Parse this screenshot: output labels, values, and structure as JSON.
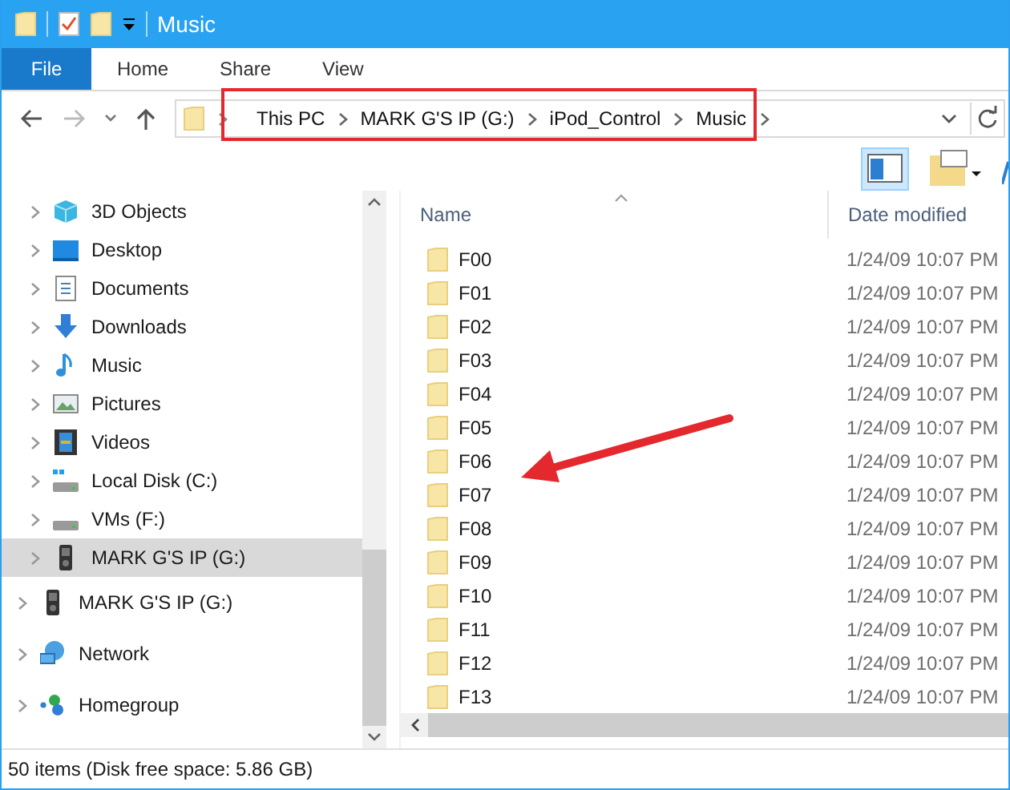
{
  "window": {
    "title": "Music"
  },
  "ribbon_tabs": [
    {
      "label": "File",
      "kind": "file"
    },
    {
      "label": "Home",
      "kind": "tab"
    },
    {
      "label": "Share",
      "kind": "tab"
    },
    {
      "label": "View",
      "kind": "tab"
    }
  ],
  "address": {
    "segments": [
      "This PC",
      "MARK G'S IP (G:)",
      "iPod_Control",
      "Music"
    ]
  },
  "sidebar": {
    "groups": [
      {
        "items": [
          {
            "label": "3D Objects",
            "kind": "objects",
            "selected": false
          },
          {
            "label": "Desktop",
            "kind": "desktop",
            "selected": false
          },
          {
            "label": "Documents",
            "kind": "documents",
            "selected": false
          },
          {
            "label": "Downloads",
            "kind": "downloads",
            "selected": false
          },
          {
            "label": "Music",
            "kind": "music",
            "selected": false
          },
          {
            "label": "Pictures",
            "kind": "pictures",
            "selected": false
          },
          {
            "label": "Videos",
            "kind": "videos",
            "selected": false
          },
          {
            "label": "Local Disk (C:)",
            "kind": "disk",
            "selected": false
          },
          {
            "label": "VMs (F:)",
            "kind": "drive",
            "selected": false
          },
          {
            "label": "MARK G'S IP (G:)",
            "kind": "player",
            "selected": true
          }
        ]
      },
      {
        "items": [
          {
            "label": "MARK G'S IP (G:)",
            "kind": "player",
            "selected": false
          },
          {
            "label": "Network",
            "kind": "network",
            "selected": false
          },
          {
            "label": "Homegroup",
            "kind": "homegroup",
            "selected": false
          }
        ]
      }
    ]
  },
  "table": {
    "columns": [
      "Name",
      "Date modified"
    ],
    "rows": [
      {
        "name": "F00",
        "date": "1/24/09 10:07 PM"
      },
      {
        "name": "F01",
        "date": "1/24/09 10:07 PM"
      },
      {
        "name": "F02",
        "date": "1/24/09 10:07 PM"
      },
      {
        "name": "F03",
        "date": "1/24/09 10:07 PM"
      },
      {
        "name": "F04",
        "date": "1/24/09 10:07 PM"
      },
      {
        "name": "F05",
        "date": "1/24/09 10:07 PM"
      },
      {
        "name": "F06",
        "date": "1/24/09 10:07 PM"
      },
      {
        "name": "F07",
        "date": "1/24/09 10:07 PM"
      },
      {
        "name": "F08",
        "date": "1/24/09 10:07 PM"
      },
      {
        "name": "F09",
        "date": "1/24/09 10:07 PM"
      },
      {
        "name": "F10",
        "date": "1/24/09 10:07 PM"
      },
      {
        "name": "F11",
        "date": "1/24/09 10:07 PM"
      },
      {
        "name": "F12",
        "date": "1/24/09 10:07 PM"
      },
      {
        "name": "F13",
        "date": "1/24/09 10:07 PM"
      }
    ]
  },
  "status_bar": "50 items (Disk free space: 5.86 GB)"
}
